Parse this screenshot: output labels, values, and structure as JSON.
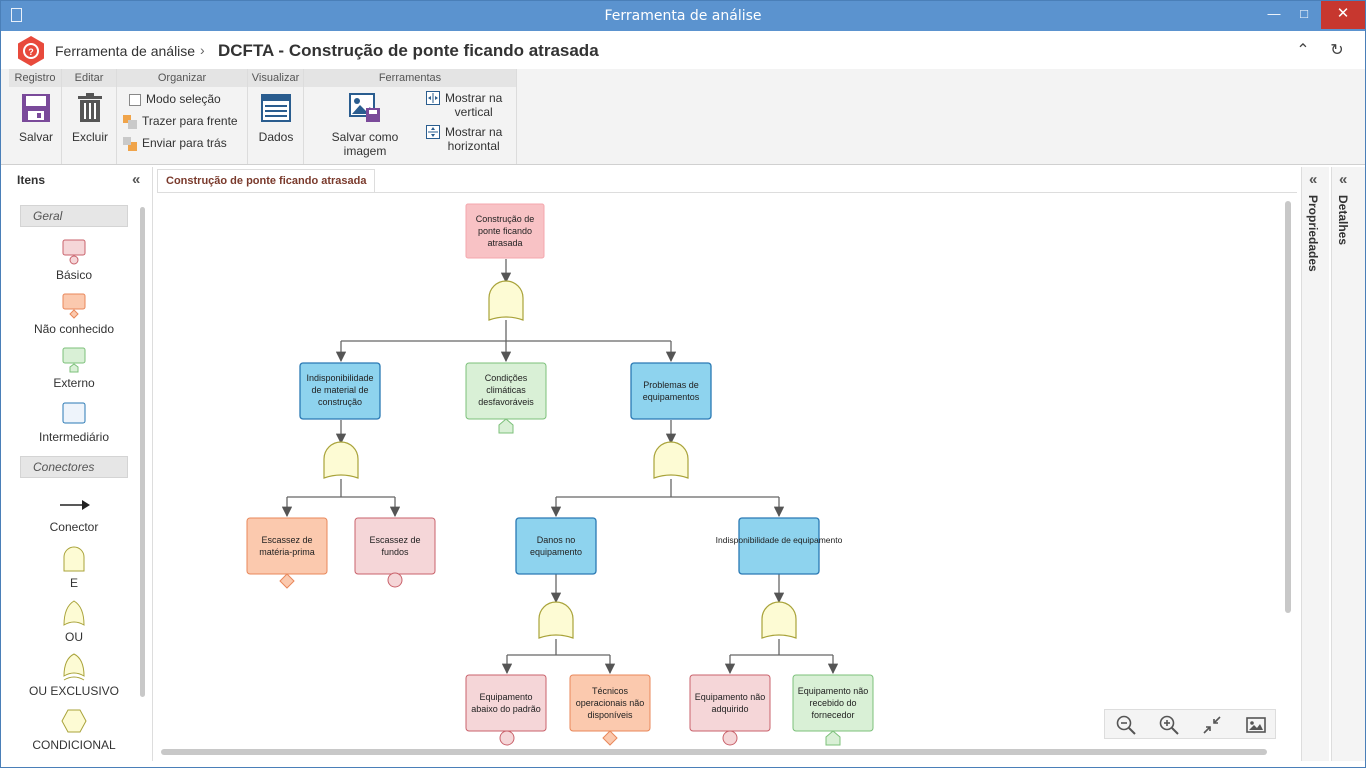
{
  "window": {
    "title": "Ferramenta de análise"
  },
  "header": {
    "app": "Ferramenta de análise",
    "separator": "›",
    "doc_title": "DCFTA - Construção de ponte ficando atrasada"
  },
  "ribbon": {
    "groups": {
      "registro": "Registro",
      "editar": "Editar",
      "organizar": "Organizar",
      "visualizar": "Visualizar",
      "ferramentas": "Ferramentas"
    },
    "salvar": "Salvar",
    "excluir": "Excluir",
    "modo_selecao": "Modo seleção",
    "trazer_frente": "Trazer para frente",
    "enviar_tras": "Enviar para trás",
    "dados": "Dados",
    "salvar_imagem": "Salvar como imagem",
    "mostrar_vertical_1": "Mostrar na",
    "mostrar_vertical_2": "vertical",
    "mostrar_horizontal_1": "Mostrar na",
    "mostrar_horizontal_2": "horizontal"
  },
  "left_panel": {
    "title": "Itens",
    "section_geral": "Geral",
    "section_conectores": "Conectores",
    "items": [
      "Básico",
      "Não conhecido",
      "Externo",
      "Intermediário"
    ],
    "connectors": [
      "Conector",
      "E",
      "OU",
      "OU EXCLUSIVO",
      "CONDICIONAL"
    ]
  },
  "tab": {
    "label": "Construção de ponte ficando atrasada"
  },
  "right_panels": {
    "propriedades": "Propriedades",
    "detalhes": "Detalhes"
  },
  "diagram": {
    "root": [
      "Construção de",
      "ponte ficando",
      "atrasada"
    ],
    "n1": [
      "Indisponibilidade",
      "de material de",
      "construção"
    ],
    "n2": [
      "Condições",
      "climáticas",
      "desfavoráveis"
    ],
    "n3": [
      "Problemas de",
      "equipamentos"
    ],
    "n4": [
      "Escassez de",
      "matéria-prima"
    ],
    "n5": [
      "Escassez de",
      "fundos"
    ],
    "n6": [
      "Danos no",
      "equipamento"
    ],
    "n7": [
      "Indisponibilidade de equipamento"
    ],
    "n8": [
      "Equipamento",
      "abaixo do padrão"
    ],
    "n9": [
      "Técnicos",
      "operacionais não",
      "disponíveis"
    ],
    "n10": [
      "Equipamento não",
      "adquirido"
    ],
    "n11": [
      "Equipamento não",
      "recebido do",
      "fornecedor"
    ]
  },
  "colors": {
    "titlebar": "#5b93cf",
    "basic_fill": "#f5d6d8",
    "basic_stroke": "#c9626b",
    "unknown_fill": "#fbc9ae",
    "unknown_stroke": "#e8875a",
    "external_fill": "#d9f0d6",
    "external_stroke": "#7cc07a",
    "intermediate_fill": "#8ed3ee",
    "intermediate_stroke": "#2a79b4",
    "top_fill": "#f8c2c5",
    "gate_fill": "#fdfbd4",
    "gate_stroke": "#a9a33a"
  }
}
